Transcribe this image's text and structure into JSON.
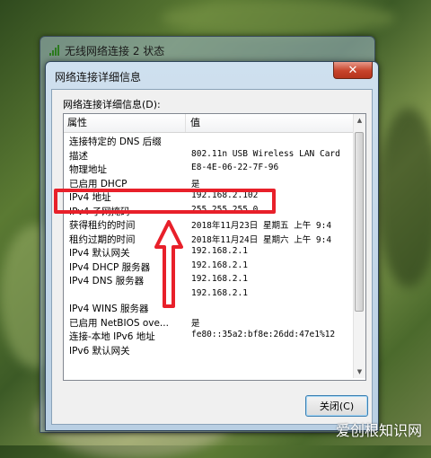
{
  "outer_window": {
    "title": "无线网络连接 2 状态"
  },
  "dialog": {
    "title": "网络连接详细信息",
    "close_glyph": "✕",
    "details_label": "网络连接详细信息(D):",
    "columns": {
      "property": "属性",
      "value": "值"
    },
    "rows": [
      {
        "property": "连接特定的 DNS 后缀",
        "value": ""
      },
      {
        "property": "描述",
        "value": "802.11n USB Wireless LAN Card"
      },
      {
        "property": "物理地址",
        "value": "E8-4E-06-22-7F-96"
      },
      {
        "property": "已启用 DHCP",
        "value": "是"
      },
      {
        "property": "IPv4 地址",
        "value": "192.168.2.102"
      },
      {
        "property": "IPv4 子网掩码",
        "value": "255.255.255.0"
      },
      {
        "property": "获得租约的时间",
        "value": "2018年11月23日 星期五 上午 9:4"
      },
      {
        "property": "租约过期的时间",
        "value": "2018年11月24日 星期六 上午 9:4"
      },
      {
        "property": "IPv4 默认网关",
        "value": "192.168.2.1"
      },
      {
        "property": "IPv4 DHCP 服务器",
        "value": "192.168.2.1"
      },
      {
        "property": "IPv4 DNS 服务器",
        "value": "192.168.2.1"
      },
      {
        "property": "",
        "value": "192.168.2.1"
      },
      {
        "property": "IPv4 WINS 服务器",
        "value": ""
      },
      {
        "property": "已启用 NetBIOS ove...",
        "value": "是"
      },
      {
        "property": "连接-本地 IPv6 地址",
        "value": "fe80::35a2:bf8e:26dd:47e1%12"
      },
      {
        "property": "IPv6 默认网关",
        "value": ""
      }
    ],
    "close_button_label": "关闭(C)"
  },
  "watermark": "爱创根知识网",
  "colors": {
    "annotation_red": "#e8202a",
    "close_red": "#c7432a"
  }
}
